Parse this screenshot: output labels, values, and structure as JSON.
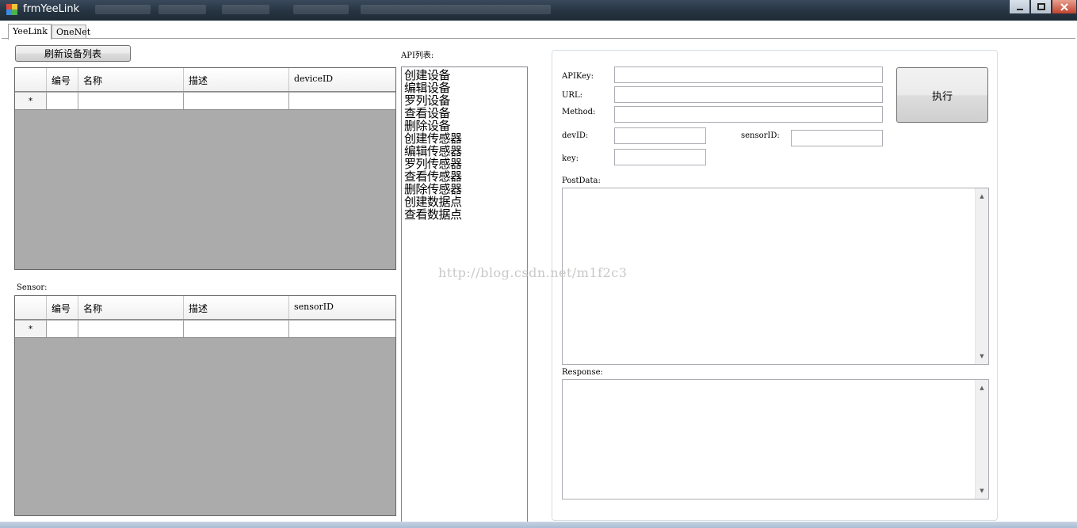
{
  "window": {
    "title": "frmYeeLink"
  },
  "tabs": [
    "YeeLink",
    "OneNet"
  ],
  "refresh_button": "刷新设备列表",
  "device_grid": {
    "columns": [
      "编号",
      "名称",
      "描述",
      "deviceID"
    ],
    "new_row_marker": "*"
  },
  "sensor_label": "Sensor:",
  "sensor_grid": {
    "columns": [
      "编号",
      "名称",
      "描述",
      "sensorID"
    ],
    "new_row_marker": "*"
  },
  "api_list": {
    "label": "API列表:",
    "items": [
      "创建设备",
      "编辑设备",
      "罗列设备",
      "查看设备",
      "删除设备",
      "创建传感器",
      "编辑传感器",
      "罗列传感器",
      "查看传感器",
      "删除传感器",
      "创建数据点",
      "查看数据点"
    ]
  },
  "form": {
    "apikey_label": "APIKey:",
    "url_label": "URL:",
    "method_label": "Method:",
    "devid_label": "devID:",
    "sensorid_label": "sensorID:",
    "key_label": "key:",
    "postdata_label": "PostData:",
    "response_label": "Response:",
    "execute_button": "执行"
  },
  "watermark": "http://blog.csdn.net/m1f2c3",
  "colors": {
    "grid_background": "#ababab",
    "titlebar": "#263442"
  },
  "icons": {
    "scroll_up": "▲",
    "scroll_down": "▼"
  }
}
